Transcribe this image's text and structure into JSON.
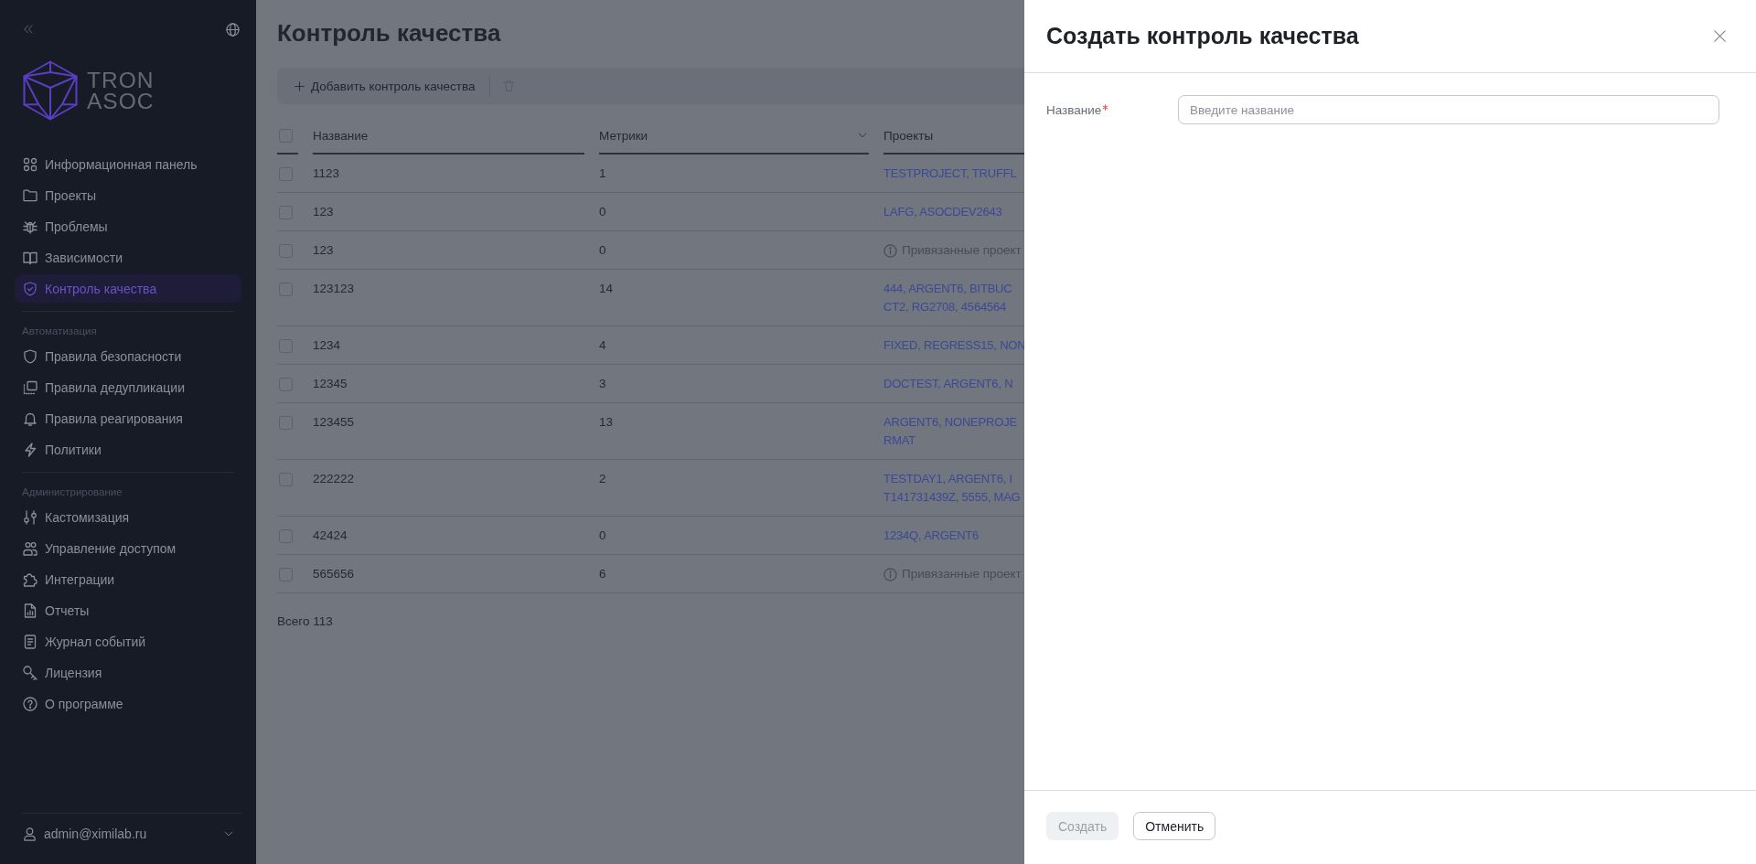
{
  "sidebar": {
    "logo": {
      "lines": [
        "TRON",
        "ASOC"
      ]
    },
    "sections": [
      {
        "items": [
          {
            "label": "Информационная панель",
            "selected": false
          },
          {
            "label": "Проекты",
            "selected": false
          },
          {
            "label": "Проблемы",
            "selected": false
          },
          {
            "label": "Зависимости",
            "selected": false
          },
          {
            "label": "Контроль качества",
            "selected": true
          }
        ]
      },
      {
        "title": "Автоматизация",
        "items": [
          {
            "label": "Правила безопасности",
            "selected": false
          },
          {
            "label": "Правила дедупликации",
            "selected": false
          },
          {
            "label": "Правила реагирования",
            "selected": false
          },
          {
            "label": "Политики",
            "selected": false
          }
        ]
      },
      {
        "title": "Администрирование",
        "items": [
          {
            "label": "Кастомизация",
            "selected": false
          },
          {
            "label": "Управление доступом",
            "selected": false
          },
          {
            "label": "Интеграции",
            "selected": false
          },
          {
            "label": "Отчеты",
            "selected": false
          },
          {
            "label": "Журнал событий",
            "selected": false
          },
          {
            "label": "Лицензия",
            "selected": false
          },
          {
            "label": "О программе",
            "selected": false
          }
        ]
      }
    ],
    "user": {
      "email": "admin@ximilab.ru"
    }
  },
  "page": {
    "title": "Контроль качества",
    "toolbar": {
      "buttons": [
        {
          "kind": "add",
          "label": "Добавить контроль качества",
          "disabled": false
        },
        {
          "kind": "delete",
          "disabled": true
        }
      ]
    },
    "table": {
      "select_all": {
        "checked": false
      },
      "columns": [
        {
          "label": "Название",
          "dropdown": false
        },
        {
          "label": "Метрики",
          "dropdown": true
        },
        {
          "label": "Проекты",
          "dropdown": false
        }
      ],
      "rows": [
        {
          "checked": false,
          "name": "1123",
          "metrics": "1",
          "projects": {
            "kind": "links",
            "lines": [
              "TESTPROJECT, TRUFFL"
            ]
          }
        },
        {
          "checked": false,
          "name": "123",
          "metrics": "0",
          "projects": {
            "kind": "links",
            "lines": [
              "LAFG, ASOCDEV2643"
            ]
          }
        },
        {
          "checked": false,
          "name": "123",
          "metrics": "0",
          "projects": {
            "kind": "note",
            "text": "Привязанные проект"
          }
        },
        {
          "checked": false,
          "name": "123123",
          "metrics": "14",
          "projects": {
            "kind": "links",
            "lines": [
              "444, ARGENT6, BITBUC",
              "CT2, RG2708, 4564564"
            ]
          }
        },
        {
          "checked": false,
          "name": "1234",
          "metrics": "4",
          "projects": {
            "kind": "links",
            "lines": [
              "FIXED, REGRESS15, NON"
            ]
          }
        },
        {
          "checked": false,
          "name": "12345",
          "metrics": "3",
          "projects": {
            "kind": "links",
            "lines": [
              "DOCTEST, ARGENT6, N"
            ]
          }
        },
        {
          "checked": false,
          "name": "123455",
          "metrics": "13",
          "projects": {
            "kind": "links",
            "lines": [
              "ARGENT6, NONEPROJE",
              "RMAT"
            ]
          }
        },
        {
          "checked": false,
          "name": "222222",
          "metrics": "2",
          "projects": {
            "kind": "links",
            "lines": [
              "TESTDAY1, ARGENT6, I",
              "T141731439Z, 5555, MAG"
            ]
          }
        },
        {
          "checked": false,
          "name": "42424",
          "metrics": "0",
          "projects": {
            "kind": "links",
            "lines": [
              "1234Q, ARGENT6"
            ]
          }
        },
        {
          "checked": false,
          "name": "565656",
          "metrics": "6",
          "projects": {
            "kind": "note",
            "text": "Привязанные проект"
          }
        }
      ]
    },
    "total": "Всего 113"
  },
  "drawer": {
    "title": "Создать контроль качества",
    "fields": [
      {
        "label": "Название",
        "required": true,
        "placeholder": "Введите название"
      }
    ],
    "buttons": [
      {
        "label": "Создать",
        "kind": "primary",
        "disabled": true
      },
      {
        "label": "Отменить",
        "kind": "secondary",
        "disabled": false
      }
    ]
  }
}
